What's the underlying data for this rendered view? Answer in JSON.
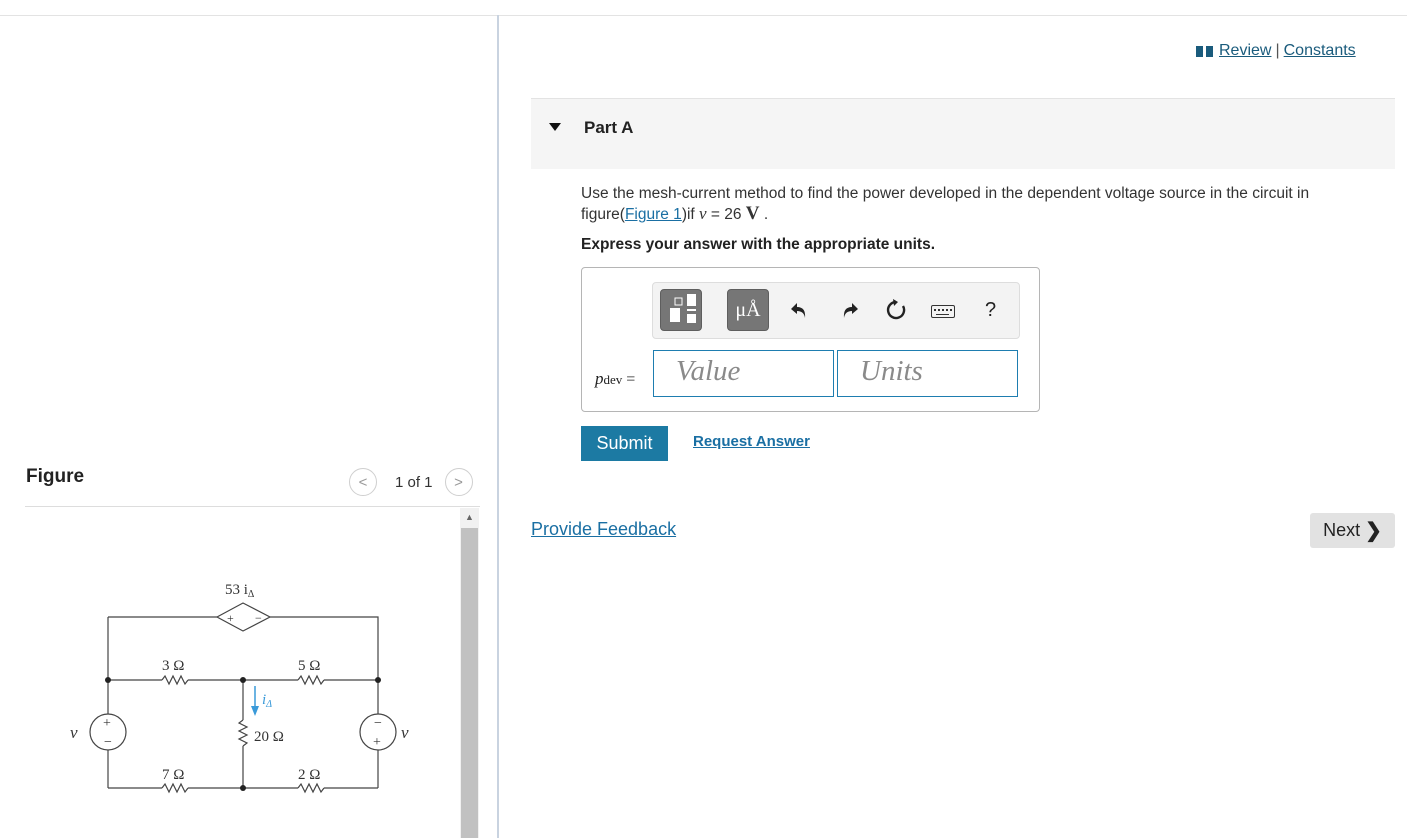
{
  "header": {
    "review_label": "Review",
    "separator": "|",
    "constants_label": "Constants"
  },
  "part": {
    "title": "Part A",
    "question_text": "Use the mesh-current method to find the power developed in the dependent voltage source in the circuit in figure(",
    "figure_link": "Figure 1",
    "question_tail": ")if ",
    "var": "v",
    "equals": " = 26 ",
    "unit": "V",
    "period": ".",
    "instruction": "Express your answer with the appropriate units."
  },
  "answer": {
    "units_button": "μÅ",
    "help_label": "?",
    "var_label": "p",
    "var_sub": "dev",
    "equals": "=",
    "value_placeholder": "Value",
    "units_placeholder": "Units"
  },
  "actions": {
    "submit_label": "Submit",
    "request_label": "Request Answer",
    "feedback_label": "Provide Feedback",
    "next_label": "Next"
  },
  "figure": {
    "title": "Figure",
    "pager_text": "1 of 1",
    "prev_glyph": "<",
    "next_glyph": ">",
    "labels": {
      "dep_source": "53 i",
      "dep_sub": "Δ",
      "r1": "3 Ω",
      "r2": "5 Ω",
      "r3": "20 Ω",
      "r4": "7 Ω",
      "r5": "2 Ω",
      "i_delta": "i",
      "i_delta_sub": "Δ",
      "v_left": "v",
      "v_right": "v",
      "plus": "+",
      "minus": "−"
    }
  },
  "colors": {
    "link": "#1a6fa3",
    "submit_bg": "#1c7aa3",
    "current_arrow": "#3a9ad9"
  }
}
